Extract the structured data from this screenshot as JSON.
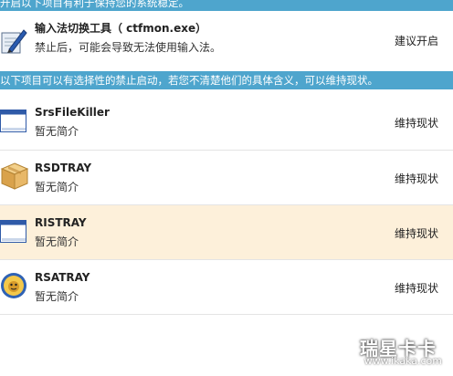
{
  "banners": {
    "top_text": "开启以下项目有利于保持您的系统稳定。",
    "middle_text": "以下项目可以有选择性的禁止启动，若您不清楚他们的具体含义，可以维持现状。"
  },
  "recommended_item": {
    "title": "输入法切换工具（ ctfmon.exe）",
    "description": "禁止后，可能会导致无法使用输入法。",
    "action": "建议开启",
    "icon": "pen-document-icon"
  },
  "optional_items": [
    {
      "title": "SrsFileKiller",
      "description": "暂无简介",
      "action": "维持现状",
      "icon": "window-icon",
      "highlighted": false
    },
    {
      "title": "RSDTRAY",
      "description": "暂无简介",
      "action": "维持现状",
      "icon": "box-icon",
      "highlighted": false
    },
    {
      "title": "RISTRAY",
      "description": "暂无简介",
      "action": "维持现状",
      "icon": "window-icon",
      "highlighted": true
    },
    {
      "title": "RSATRAY",
      "description": "暂无简介",
      "action": "维持现状",
      "icon": "rising-lion-icon",
      "highlighted": false
    }
  ],
  "watermark": {
    "logo_text": "瑞星卡卡",
    "url": "www.ikaka.com"
  }
}
